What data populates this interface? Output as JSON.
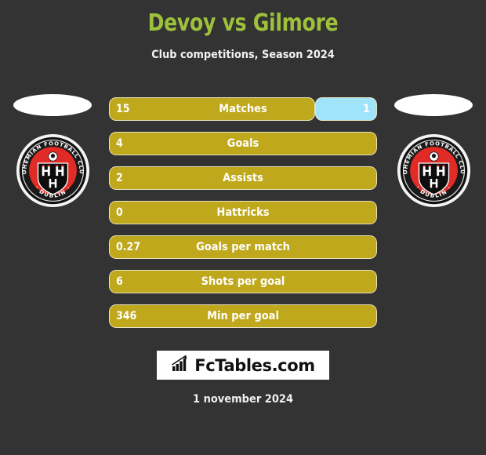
{
  "header": {
    "title": "Devoy vs Gilmore",
    "subtitle": "Club competitions, Season 2024"
  },
  "home": {
    "player_name": "Devoy",
    "club_name": "Bohemian Football Club",
    "club_city": "Dublin",
    "crest_icon": "bohemian-fc-crest-icon",
    "photo_icon": "player-photo-placeholder"
  },
  "away": {
    "player_name": "Gilmore",
    "club_name": "Bohemian Football Club",
    "club_city": "Dublin",
    "crest_icon": "bohemian-fc-crest-icon",
    "photo_icon": "player-photo-placeholder"
  },
  "colors": {
    "background": "#333333",
    "title": "#9ec13c",
    "home_bar": "#bfa81b",
    "away_bar": "#9fe4fb",
    "bar_border": "#e9e4c0",
    "text": "#ffffff"
  },
  "footer": {
    "brand": "FcTables.com",
    "brand_icon": "bar-chart-growth-icon",
    "date": "1 november 2024"
  },
  "chart_data": {
    "type": "bar",
    "title": "Devoy vs Gilmore",
    "subtitle": "Club competitions, Season 2024",
    "orientation": "horizontal",
    "legend": [
      "Devoy",
      "Gilmore"
    ],
    "categories": [
      "Matches",
      "Goals",
      "Assists",
      "Hattricks",
      "Goals per match",
      "Shots per goal",
      "Min per goal"
    ],
    "series": [
      {
        "name": "Devoy",
        "values": [
          15,
          4,
          2,
          0,
          0.27,
          6,
          346
        ],
        "color": "#bfa81b"
      },
      {
        "name": "Gilmore",
        "values": [
          1,
          null,
          null,
          null,
          null,
          null,
          null
        ],
        "color": "#9fe4fb"
      }
    ],
    "rows": [
      {
        "label": "Matches",
        "home": "15",
        "away": "1",
        "home_pct": 77,
        "away_pct": 23,
        "has_away": true
      },
      {
        "label": "Goals",
        "home": "4",
        "away": "",
        "home_pct": 100,
        "away_pct": 0,
        "has_away": false
      },
      {
        "label": "Assists",
        "home": "2",
        "away": "",
        "home_pct": 100,
        "away_pct": 0,
        "has_away": false
      },
      {
        "label": "Hattricks",
        "home": "0",
        "away": "",
        "home_pct": 100,
        "away_pct": 0,
        "has_away": false
      },
      {
        "label": "Goals per match",
        "home": "0.27",
        "away": "",
        "home_pct": 100,
        "away_pct": 0,
        "has_away": false
      },
      {
        "label": "Shots per goal",
        "home": "6",
        "away": "",
        "home_pct": 100,
        "away_pct": 0,
        "has_away": false
      },
      {
        "label": "Min per goal",
        "home": "346",
        "away": "",
        "home_pct": 100,
        "away_pct": 0,
        "has_away": false
      }
    ]
  }
}
